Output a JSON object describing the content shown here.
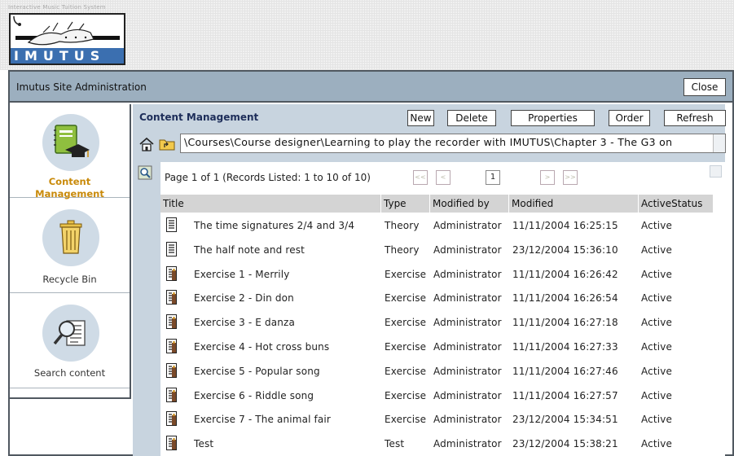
{
  "branding": {
    "tagline": "Interactive Music Tuition System",
    "logo_letters": "IMUTUS"
  },
  "window": {
    "title": "Imutus Site Administration",
    "close_label": "Close"
  },
  "sidebar": {
    "items": [
      {
        "label_line1": "Content",
        "label_line2": "Management",
        "icon": "notebook-graduation-cap-icon",
        "active": true
      },
      {
        "label": "Recycle Bin",
        "icon": "recycle-bin-icon",
        "active": false
      },
      {
        "label": "Search content",
        "icon": "magnifier-document-icon",
        "active": false
      }
    ]
  },
  "content": {
    "title": "Content Management",
    "toolbar": {
      "new_label": "New",
      "delete_label": "Delete",
      "properties_label": "Properties",
      "order_label": "Order",
      "refresh_label": "Refresh"
    },
    "path": "\\Courses\\Course designer\\Learning to play the recorder with IMUTUS\\Chapter 3 - The G3 on"
  },
  "pager": {
    "text": "Page 1 of 1 (Records Listed: 1 to 10 of 10)",
    "first": "<<",
    "prev": "<",
    "current": "1",
    "next": ">",
    "last": ">>"
  },
  "table": {
    "columns": [
      "Title",
      "Type",
      "Modified by",
      "Modified",
      "ActiveStatus"
    ],
    "rows": [
      {
        "title": "The time signatures 2/4 and 3/4",
        "type": "Theory",
        "modified_by": "Administrator",
        "modified": "11/11/2004 16:25:15",
        "status": "Active",
        "icon": "theory-document-icon"
      },
      {
        "title": "The half note and rest",
        "type": "Theory",
        "modified_by": "Administrator",
        "modified": "23/12/2004 15:36:10",
        "status": "Active",
        "icon": "theory-document-icon"
      },
      {
        "title": "Exercise 1 - Merrily",
        "type": "Exercise",
        "modified_by": "Administrator",
        "modified": "11/11/2004 16:26:42",
        "status": "Active",
        "icon": "exercise-document-icon"
      },
      {
        "title": "Exercise 2 - Din don",
        "type": "Exercise",
        "modified_by": "Administrator",
        "modified": "11/11/2004 16:26:54",
        "status": "Active",
        "icon": "exercise-document-icon"
      },
      {
        "title": "Exercise 3 - E danza",
        "type": "Exercise",
        "modified_by": "Administrator",
        "modified": "11/11/2004 16:27:18",
        "status": "Active",
        "icon": "exercise-document-icon"
      },
      {
        "title": "Exercise 4 - Hot cross buns",
        "type": "Exercise",
        "modified_by": "Administrator",
        "modified": "11/11/2004 16:27:33",
        "status": "Active",
        "icon": "exercise-document-icon"
      },
      {
        "title": "Exercise 5 - Popular song",
        "type": "Exercise",
        "modified_by": "Administrator",
        "modified": "11/11/2004 16:27:46",
        "status": "Active",
        "icon": "exercise-document-icon"
      },
      {
        "title": "Exercise 6 - Riddle song",
        "type": "Exercise",
        "modified_by": "Administrator",
        "modified": "11/11/2004 16:27:57",
        "status": "Active",
        "icon": "exercise-document-icon"
      },
      {
        "title": "Exercise 7 - The animal fair",
        "type": "Exercise",
        "modified_by": "Administrator",
        "modified": "23/12/2004 15:34:51",
        "status": "Active",
        "icon": "exercise-document-icon"
      },
      {
        "title": "Test",
        "type": "Test",
        "modified_by": "Administrator",
        "modified": "23/12/2004 15:38:21",
        "status": "Active",
        "icon": "exercise-document-icon"
      }
    ]
  },
  "colors": {
    "titlebar": "#9cafbf",
    "panel": "#c8d4df",
    "active_label": "#c98a0a",
    "logo_blue": "#3b6fb0"
  }
}
